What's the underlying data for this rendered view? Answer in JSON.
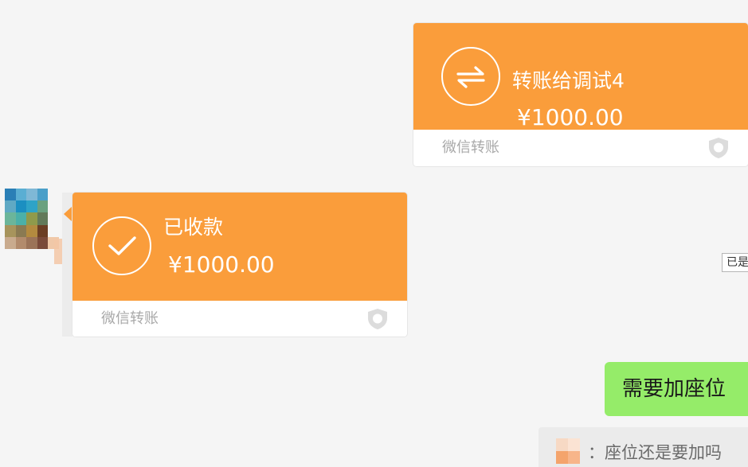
{
  "messages": {
    "sent_transfer": {
      "title": "转账给调试4",
      "amount": "¥1000.00",
      "footer": "微信转账",
      "icon": "transfer-arrows-icon"
    },
    "received_transfer": {
      "title": "已收款",
      "amount": "¥1000.00",
      "footer": "微信转账",
      "icon": "check-circle-icon"
    },
    "text_bubble": {
      "text": "需要加座位"
    },
    "quote": {
      "text": "：座位还是要加吗"
    },
    "edge_tag": {
      "text": "已是"
    }
  },
  "colors": {
    "transfer_orange": "#fa9d3b",
    "bubble_green": "#95ec69",
    "background": "#f5f5f5"
  }
}
